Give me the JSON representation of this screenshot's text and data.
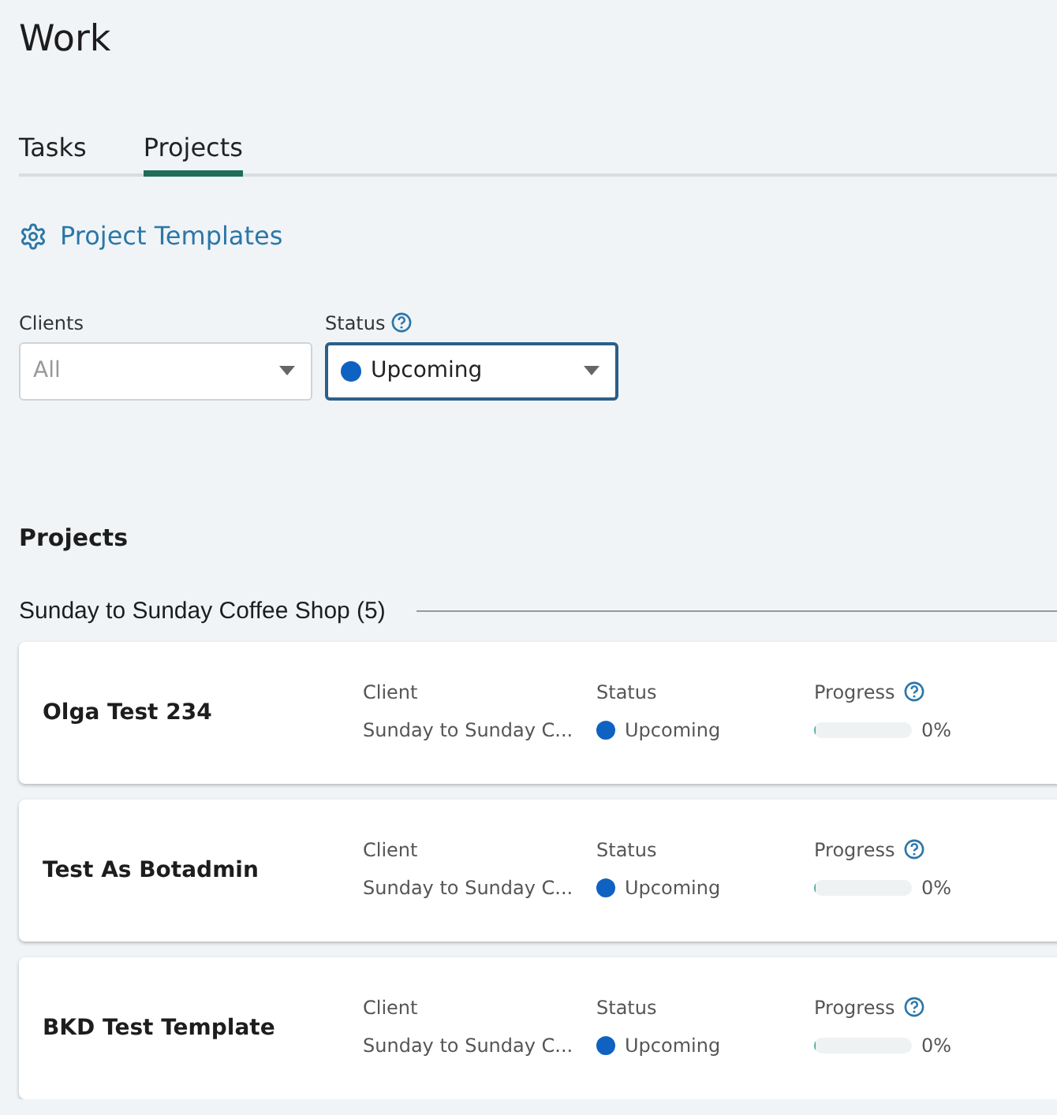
{
  "title": "Work",
  "tabs": [
    {
      "label": "Tasks",
      "selected": false
    },
    {
      "label": "Projects",
      "selected": true
    }
  ],
  "templates_link": "Project Templates",
  "filters": [
    {
      "label": "Clients",
      "help": false,
      "value": "All",
      "placeholder": true,
      "focused": false,
      "dot": false
    },
    {
      "label": "Status",
      "help": true,
      "value": "Upcoming",
      "placeholder": false,
      "focused": true,
      "dot": true
    }
  ],
  "section_title": "Projects",
  "group": {
    "title": "Sunday to Sunday Coffee Shop (5)"
  },
  "projects": [
    {
      "name": "Olga Test 234",
      "client_label": "Client",
      "client": "Sunday to Sunday C...",
      "status_label": "Status",
      "status": "Upcoming",
      "progress_label": "Progress",
      "level": 0.02,
      "percent": "0%"
    },
    {
      "name": "Test As Botadmin",
      "client_label": "Client",
      "client": "Sunday to Sunday C...",
      "status_label": "Status",
      "status": "Upcoming",
      "progress_label": "Progress",
      "level": 0.02,
      "percent": "0%"
    },
    {
      "name": "BKD Test Template",
      "client_label": "Client",
      "client": "Sunday to Sunday C...",
      "status_label": "Status",
      "status": "Upcoming",
      "progress_label": "Progress",
      "level": 0.02,
      "percent": "0%"
    }
  ]
}
